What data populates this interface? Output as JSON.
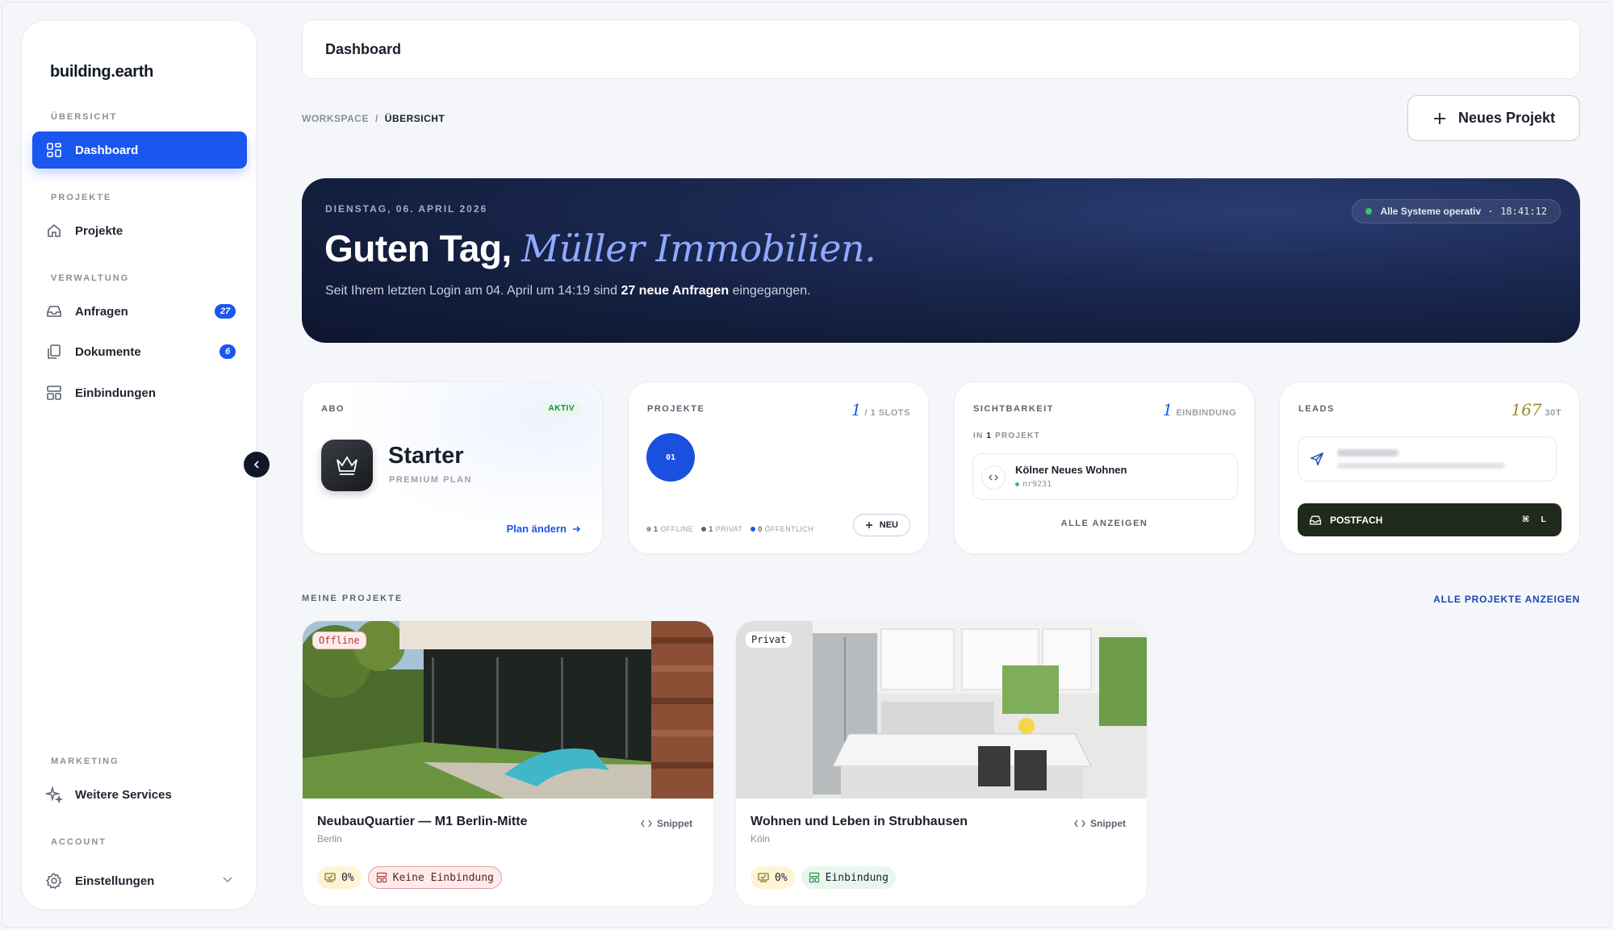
{
  "app": {
    "brand": "building.earth"
  },
  "sidebar": {
    "sections": {
      "overview": "ÜBERSICHT",
      "projects": "PROJEKTE",
      "admin": "VERWALTUNG",
      "marketing": "MARKETING",
      "account": "ACCOUNT"
    },
    "items": {
      "dashboard": "Dashboard",
      "projekte": "Projekte",
      "anfragen": "Anfragen",
      "anfragen_badge": "27",
      "dokumente": "Dokumente",
      "dokumente_badge": "6",
      "einbindungen": "Einbindungen",
      "services": "Weitere Services",
      "einstellungen": "Einstellungen"
    }
  },
  "topbar": {
    "title": "Dashboard"
  },
  "breadcrumb": {
    "root": "WORKSPACE",
    "sep": "/",
    "current": "ÜBERSICHT"
  },
  "actions": {
    "new_project": "Neues Projekt"
  },
  "hero": {
    "date": "DIENSTAG, 06. APRIL 2026",
    "greeting": "Guten Tag,",
    "name": "Müller Immobilien.",
    "sub_pre": "Seit Ihrem letzten Login am 04. April um 14:19 sind",
    "sub_bold": "27 neue Anfragen",
    "sub_post": "eingegangen.",
    "status": "Alle Systeme operativ",
    "status_sep": "·",
    "time": "18:41:12"
  },
  "cards": {
    "abo": {
      "label": "ABO",
      "badge": "AKTIV",
      "plan": "Starter",
      "plan_sub": "PREMIUM PLAN",
      "link": "Plan ändern"
    },
    "projekte": {
      "label": "PROJEKTE",
      "count": "1",
      "unit": "/ 1 SLOTS",
      "circle": "01",
      "legend": [
        {
          "num": "1",
          "label": "OFFLINE",
          "color": "#9aa0aa"
        },
        {
          "num": "1",
          "label": "PRIVAT",
          "color": "#5d6370"
        },
        {
          "num": "0",
          "label": "ÖFFENTLICH",
          "color": "#1a56f0"
        }
      ],
      "new_btn": "NEU"
    },
    "sichtbarkeit": {
      "label": "SICHTBARKEIT",
      "count": "1",
      "unit": "EINBINDUNG",
      "sub_pre": "IN",
      "sub_num": "1",
      "sub_post": "PROJEKT",
      "embed_title": "Kölner Neues Wohnen",
      "embed_id": "nr9231",
      "show_all": "ALLE ANZEIGEN"
    },
    "leads": {
      "label": "LEADS",
      "count": "167",
      "unit": "30T",
      "inbox": "POSTFACH",
      "kbd1": "⌘",
      "kbd2": "L"
    }
  },
  "projects": {
    "label": "MEINE PROJEKTE",
    "all_link": "ALLE PROJEKTE ANZEIGEN",
    "items": [
      {
        "status": "Offline",
        "title": "NeubauQuartier — M1 Berlin-Mitte",
        "city": "Berlin",
        "snippet": "Snippet",
        "progress": "0%",
        "embed": "Keine Einbindung"
      },
      {
        "status": "Privat",
        "title": "Wohnen und Leben in Strubhausen",
        "city": "Köln",
        "snippet": "Snippet",
        "progress": "0%",
        "embed": "Einbindung"
      }
    ]
  }
}
